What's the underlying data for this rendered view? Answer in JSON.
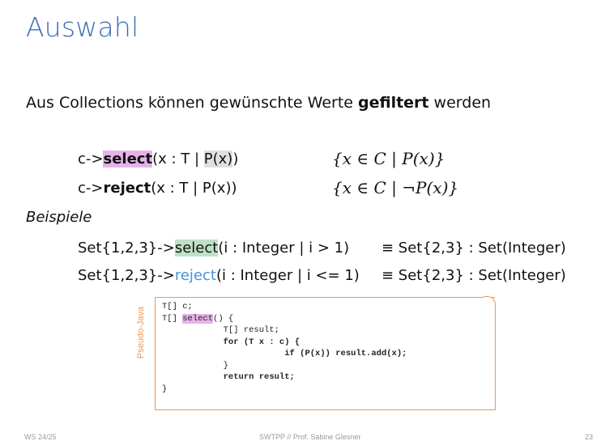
{
  "title": "Auswahl",
  "intro": {
    "pre": "Aus Collections können gewünschte Werte ",
    "bold": "gefiltert",
    "post": " werden"
  },
  "rules": [
    {
      "prefix": "c->",
      "op": "select",
      "args_open": "(x : T | ",
      "pred": "P(x)",
      "args_close": ")",
      "math": "{x ∈ C | P(x)}"
    },
    {
      "prefix": "c->",
      "op": "reject",
      "args_open": "(x : T | ",
      "pred": "P(x)",
      "args_close": ")",
      "math": "{x ∈ C | ¬P(x)}"
    }
  ],
  "beispiele": "Beispiele",
  "examples": [
    {
      "prefix": "Set{1,2,3}->",
      "op": "select",
      "args": "(i : Integer | i > 1)",
      "result": "≡ Set{2,3} : Set(Integer)"
    },
    {
      "prefix": "Set{1,2,3}->",
      "op": "reject",
      "args": "(i : Integer | i <= 1)",
      "result": "≡ Set{2,3} : Set(Integer)"
    }
  ],
  "code": {
    "side_label": "Pseudo-Java",
    "l1": "T[] c;",
    "l2_pre": "T[] ",
    "l2_op": "select",
    "l2_post": "() {",
    "l3": "T[] result;",
    "l4": "for (T x : c) {",
    "l5": "if (P(x)) result.add(x);",
    "l6": "}",
    "l7": "return result;",
    "l8": "}"
  },
  "footer": {
    "left": "WS 24/25",
    "center": "SWTPP // Prof. Sabine Glesner",
    "right": "23"
  }
}
